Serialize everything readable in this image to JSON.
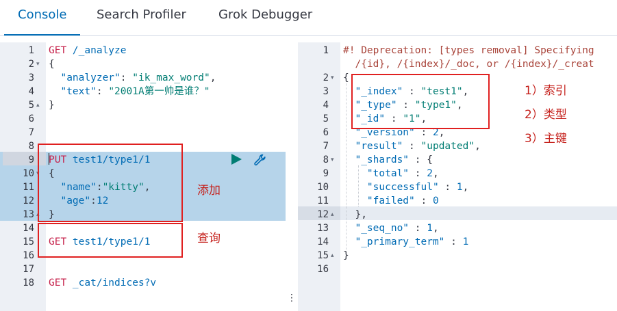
{
  "tabs": [
    {
      "label": "Console",
      "active": true
    },
    {
      "label": "Search Profiler",
      "active": false
    },
    {
      "label": "Grok Debugger",
      "active": false
    }
  ],
  "request_editor": {
    "lines": [
      {
        "num": "1",
        "fold": "",
        "tokens": [
          {
            "t": "GET",
            "c": "m"
          },
          {
            "t": " /_analyze",
            "c": "u"
          }
        ]
      },
      {
        "num": "2",
        "fold": "▾",
        "tokens": [
          {
            "t": "{",
            "c": "p"
          }
        ]
      },
      {
        "num": "3",
        "fold": "",
        "tokens": [
          {
            "t": "  \"analyzer\"",
            "c": "k"
          },
          {
            "t": ": ",
            "c": "p"
          },
          {
            "t": "\"ik_max_word\"",
            "c": "s"
          },
          {
            "t": ",",
            "c": "p"
          }
        ]
      },
      {
        "num": "4",
        "fold": "",
        "tokens": [
          {
            "t": "  \"text\"",
            "c": "k"
          },
          {
            "t": ": ",
            "c": "p"
          },
          {
            "t": "\"2001A第一帅是谁？\"",
            "c": "s"
          }
        ]
      },
      {
        "num": "5",
        "fold": "▴",
        "tokens": [
          {
            "t": "}",
            "c": "p"
          }
        ]
      },
      {
        "num": "6",
        "fold": "",
        "tokens": []
      },
      {
        "num": "7",
        "fold": "",
        "tokens": []
      },
      {
        "num": "8",
        "fold": "",
        "tokens": []
      },
      {
        "num": "9",
        "fold": "",
        "tokens": [
          {
            "t": "PUT",
            "c": "m"
          },
          {
            "t": " test1/type1/1",
            "c": "u"
          }
        ]
      },
      {
        "num": "10",
        "fold": "▾",
        "tokens": [
          {
            "t": "{",
            "c": "p"
          }
        ]
      },
      {
        "num": "11",
        "fold": "",
        "tokens": [
          {
            "t": "  \"name\"",
            "c": "k"
          },
          {
            "t": ":",
            "c": "p"
          },
          {
            "t": "\"kitty\"",
            "c": "s"
          },
          {
            "t": ",",
            "c": "p"
          }
        ]
      },
      {
        "num": "12",
        "fold": "",
        "tokens": [
          {
            "t": "  \"age\"",
            "c": "k"
          },
          {
            "t": ":",
            "c": "p"
          },
          {
            "t": "12",
            "c": "n"
          }
        ]
      },
      {
        "num": "13",
        "fold": "▴",
        "tokens": [
          {
            "t": "}",
            "c": "p"
          }
        ]
      },
      {
        "num": "14",
        "fold": "",
        "tokens": []
      },
      {
        "num": "15",
        "fold": "",
        "tokens": [
          {
            "t": "GET",
            "c": "m"
          },
          {
            "t": " test1/type1/1",
            "c": "u"
          }
        ]
      },
      {
        "num": "16",
        "fold": "",
        "tokens": []
      },
      {
        "num": "17",
        "fold": "",
        "tokens": []
      },
      {
        "num": "18",
        "fold": "",
        "tokens": [
          {
            "t": "GET",
            "c": "m"
          },
          {
            "t": " _cat/indices?v",
            "c": "u"
          }
        ]
      }
    ]
  },
  "response_editor": {
    "lines": [
      {
        "num": "1",
        "fold": "",
        "tokens": [
          {
            "t": "#! Deprecation: [types removal] Specifying",
            "c": "c"
          }
        ]
      },
      {
        "num": "",
        "fold": "",
        "tokens": [
          {
            "t": "  /{id}, /{index}/_doc, or /{index}/_creat",
            "c": "c"
          }
        ]
      },
      {
        "num": "2",
        "fold": "▾",
        "tokens": [
          {
            "t": "{",
            "c": "p"
          }
        ]
      },
      {
        "num": "3",
        "fold": "",
        "tokens": [
          {
            "t": "  \"_index\"",
            "c": "k"
          },
          {
            "t": " : ",
            "c": "p"
          },
          {
            "t": "\"test1\"",
            "c": "s"
          },
          {
            "t": ",",
            "c": "p"
          }
        ]
      },
      {
        "num": "4",
        "fold": "",
        "tokens": [
          {
            "t": "  \"_type\"",
            "c": "k"
          },
          {
            "t": " : ",
            "c": "p"
          },
          {
            "t": "\"type1\"",
            "c": "s"
          },
          {
            "t": ",",
            "c": "p"
          }
        ]
      },
      {
        "num": "5",
        "fold": "",
        "tokens": [
          {
            "t": "  \"_id\"",
            "c": "k"
          },
          {
            "t": " : ",
            "c": "p"
          },
          {
            "t": "\"1\"",
            "c": "s"
          },
          {
            "t": ",",
            "c": "p"
          }
        ]
      },
      {
        "num": "6",
        "fold": "",
        "tokens": [
          {
            "t": "  \"_version\"",
            "c": "k"
          },
          {
            "t": " : ",
            "c": "p"
          },
          {
            "t": "2",
            "c": "n"
          },
          {
            "t": ",",
            "c": "p"
          }
        ]
      },
      {
        "num": "7",
        "fold": "",
        "tokens": [
          {
            "t": "  \"result\"",
            "c": "k"
          },
          {
            "t": " : ",
            "c": "p"
          },
          {
            "t": "\"updated\"",
            "c": "s"
          },
          {
            "t": ",",
            "c": "p"
          }
        ]
      },
      {
        "num": "8",
        "fold": "▾",
        "tokens": [
          {
            "t": "  \"_shards\"",
            "c": "k"
          },
          {
            "t": " : {",
            "c": "p"
          }
        ]
      },
      {
        "num": "9",
        "fold": "",
        "tokens": [
          {
            "t": "    \"total\"",
            "c": "k"
          },
          {
            "t": " : ",
            "c": "p"
          },
          {
            "t": "2",
            "c": "n"
          },
          {
            "t": ",",
            "c": "p"
          }
        ]
      },
      {
        "num": "10",
        "fold": "",
        "tokens": [
          {
            "t": "    \"successful\"",
            "c": "k"
          },
          {
            "t": " : ",
            "c": "p"
          },
          {
            "t": "1",
            "c": "n"
          },
          {
            "t": ",",
            "c": "p"
          }
        ]
      },
      {
        "num": "11",
        "fold": "",
        "tokens": [
          {
            "t": "    \"failed\"",
            "c": "k"
          },
          {
            "t": " : ",
            "c": "p"
          },
          {
            "t": "0",
            "c": "n"
          }
        ]
      },
      {
        "num": "12",
        "fold": "▴",
        "tokens": [
          {
            "t": "  },",
            "c": "p"
          }
        ]
      },
      {
        "num": "13",
        "fold": "",
        "tokens": [
          {
            "t": "  \"_seq_no\"",
            "c": "k"
          },
          {
            "t": " : ",
            "c": "p"
          },
          {
            "t": "1",
            "c": "n"
          },
          {
            "t": ",",
            "c": "p"
          }
        ]
      },
      {
        "num": "14",
        "fold": "",
        "tokens": [
          {
            "t": "  \"_primary_term\"",
            "c": "k"
          },
          {
            "t": " : ",
            "c": "p"
          },
          {
            "t": "1",
            "c": "n"
          }
        ]
      },
      {
        "num": "15",
        "fold": "▴",
        "tokens": [
          {
            "t": "}",
            "c": "p"
          }
        ]
      },
      {
        "num": "16",
        "fold": "",
        "tokens": []
      }
    ]
  },
  "actions": {
    "run_icon": "play-icon",
    "settings_icon": "wrench-icon",
    "menu_icon": "vertical-dots-icon"
  },
  "annotations": {
    "add": "添加",
    "query": "查询",
    "index": "1）索引",
    "type": "2）类型",
    "id": "3）主键"
  },
  "colors": {
    "accent": "#006bb4",
    "method": "#c7254e",
    "string": "#017d73",
    "selection": "#b6d4ea",
    "annotation": "#e02020"
  }
}
